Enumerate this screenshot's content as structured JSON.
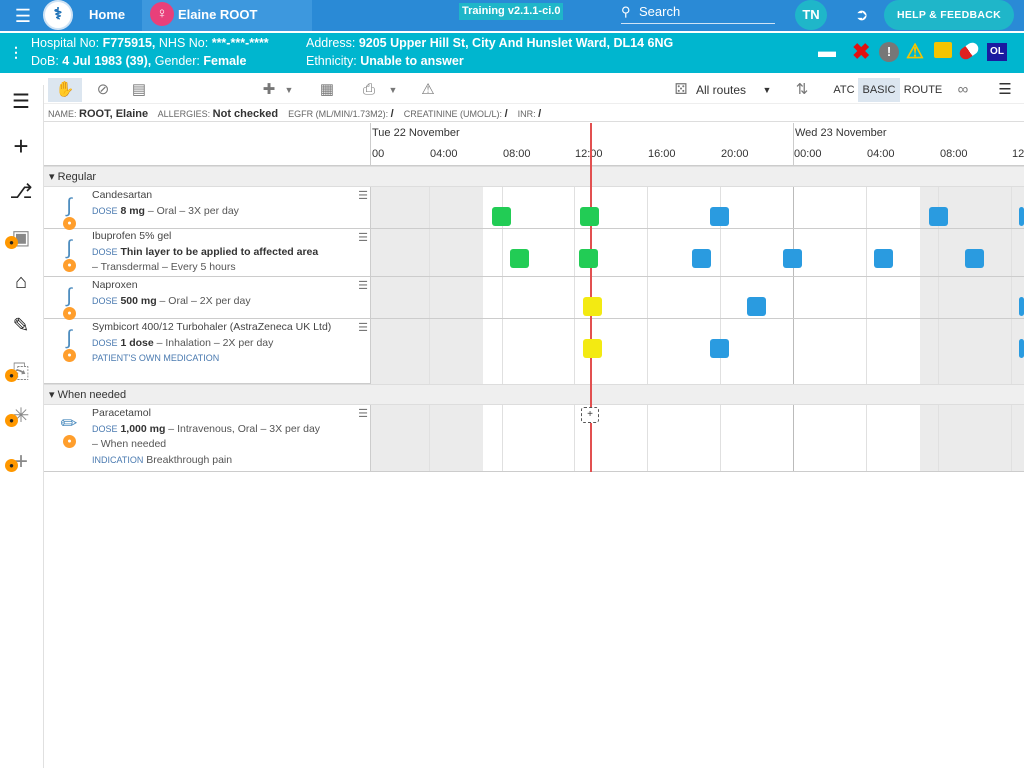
{
  "topbar": {
    "home_label": "Home",
    "patient_name": "Elaine ROOT",
    "training_badge": "Training v2.1.1-ci.0",
    "search_label": "Search",
    "user_initials": "TN",
    "help_label": "HELP & FEEDBACK"
  },
  "patient_band": {
    "hospital_label": "Hospital No:",
    "hospital_no": "F775915,",
    "nhs_label": "NHS No:",
    "nhs_no": "***-***-****",
    "dob_label": "DoB:",
    "dob": "4 Jul 1983 (39),",
    "gender_label": "Gender:",
    "gender": "Female",
    "address_label": "Address:",
    "address": "9205 Upper Hill St, City And Hunslet Ward, DL14 6NG",
    "ethnicity_label": "Ethnicity:",
    "ethnicity": "Unable to answer",
    "ol_badge": "OL"
  },
  "toolbar": {
    "routes_label": "All routes",
    "atc_label": "ATC",
    "basic_label": "BASIC",
    "route_label": "ROUTE"
  },
  "info_bar": {
    "name_label": "NAME:",
    "name": "ROOT, Elaine",
    "allergies_label": "ALLERGIES:",
    "allergies": "Not checked",
    "egfr_label": "EGFR (ML/MIN/1.73M2):",
    "egfr": "/",
    "creat_label": "CREATININE (UMOL/L):",
    "creat": "/",
    "inr_label": "INR:",
    "inr": "/"
  },
  "timeline": {
    "day1": "Tue 22 November",
    "day2": "Wed 23 November",
    "hours": [
      "00",
      "04:00",
      "08:00",
      "12:00",
      "16:00",
      "20:00",
      "00:00",
      "04:00",
      "08:00",
      "12"
    ]
  },
  "sections": {
    "regular": "Regular",
    "when_needed": "When needed"
  },
  "dose_key": "DOSE",
  "medications": [
    {
      "name": "Candesartan",
      "dose": "8 mg",
      "detail": " – Oral – 3X per day",
      "extra": "",
      "tag": ""
    },
    {
      "name": "Ibuprofen 5% gel",
      "dose": "Thin layer to be applied to affected area",
      "detail": "",
      "extra": "– Transdermal – Every 5 hours",
      "tag": ""
    },
    {
      "name": "Naproxen",
      "dose": "500 mg",
      "detail": " – Oral – 2X per day",
      "extra": "",
      "tag": ""
    },
    {
      "name": "Symbicort 400/12 Turbohaler (AstraZeneca UK Ltd)",
      "dose": "1 dose",
      "detail": " – Inhalation – 2X per day",
      "extra": "",
      "tag": "PATIENT'S OWN MEDICATION"
    },
    {
      "name": "Paracetamol",
      "dose": "1,000 mg",
      "detail": " – Intravenous, Oral – 3X per day",
      "extra": "– When needed",
      "tag": "",
      "indication_label": "INDICATION",
      "indication": "Breakthrough pain"
    }
  ],
  "colors": {
    "given": "#22cc55",
    "planned": "#2a9be0",
    "due": "#f3ea12",
    "now_line": "#e25050"
  }
}
